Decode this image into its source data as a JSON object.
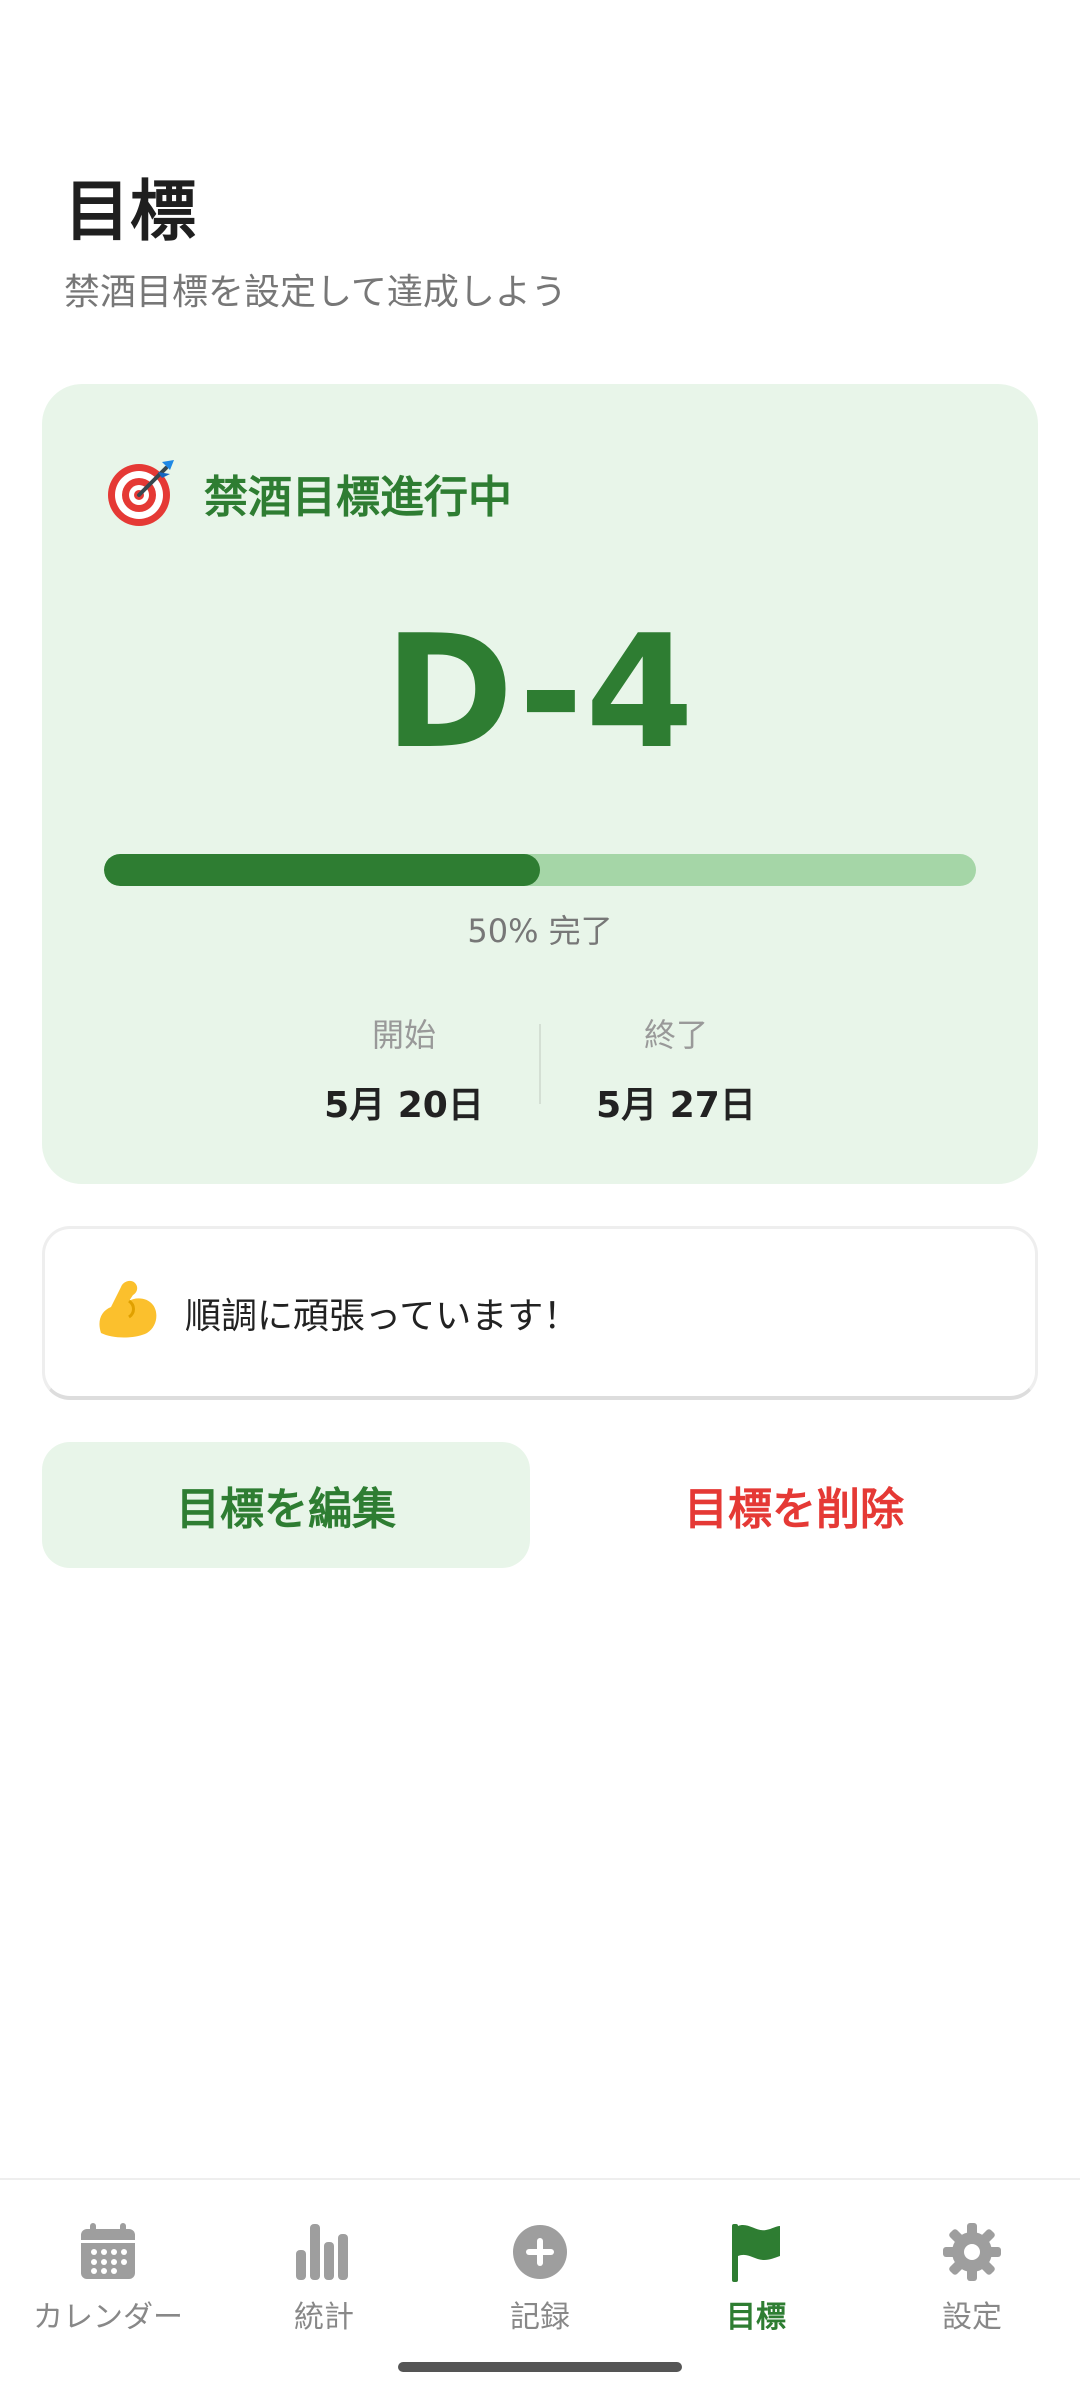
{
  "header": {
    "title": "目標",
    "subtitle": "禁酒目標を設定して達成しよう"
  },
  "goal_card": {
    "icon": "target-icon",
    "title": "禁酒目標進行中",
    "countdown": "D-4",
    "progress_fraction": 0.5,
    "progress_text": "50% 完了",
    "start_label": "開始",
    "start_value": "5月 20日",
    "end_label": "終了",
    "end_value": "5月 27日",
    "colors": {
      "accent": "#2e7d32",
      "card_bg": "#e8f5e9",
      "track": "#a5d6a7"
    }
  },
  "message": {
    "icon": "flexed-biceps-icon",
    "text": "順調に頑張っています！"
  },
  "actions": {
    "edit_label": "目標を編集",
    "delete_label": "目標を削除",
    "delete_color": "#e53935"
  },
  "nav": {
    "active": "goal",
    "items": [
      {
        "id": "calendar",
        "label": "カレンダー",
        "icon": "calendar-icon"
      },
      {
        "id": "stats",
        "label": "統計",
        "icon": "bar-chart-icon"
      },
      {
        "id": "record",
        "label": "記録",
        "icon": "add-circle-icon"
      },
      {
        "id": "goal",
        "label": "目標",
        "icon": "flag-icon"
      },
      {
        "id": "settings",
        "label": "設定",
        "icon": "gear-icon"
      }
    ]
  }
}
